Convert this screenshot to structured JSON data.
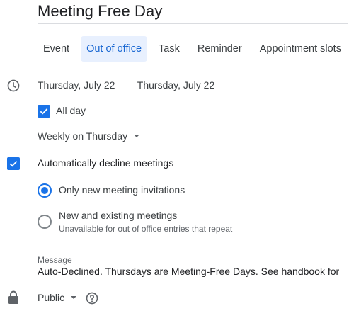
{
  "event": {
    "title": "Meeting Free Day"
  },
  "tabs": [
    {
      "label": "Event"
    },
    {
      "label": "Out of office"
    },
    {
      "label": "Task"
    },
    {
      "label": "Reminder"
    },
    {
      "label": "Appointment slots"
    }
  ],
  "active_tab": "Out of office",
  "date": {
    "start": "Thursday, July 22",
    "separator": "–",
    "end": "Thursday, July 22"
  },
  "all_day": {
    "label": "All day",
    "checked": true
  },
  "recurrence": {
    "value": "Weekly on Thursday"
  },
  "decline": {
    "label": "Automatically decline meetings",
    "checked": true,
    "options": [
      {
        "label": "Only new meeting invitations",
        "selected": true
      },
      {
        "label": "New and existing meetings",
        "selected": false,
        "note": "Unavailable for out of office entries that repeat"
      }
    ]
  },
  "message": {
    "label": "Message",
    "text": "Auto-Declined. Thursdays are Meeting-Free Days. See handbook for more details."
  },
  "visibility": {
    "value": "Public"
  },
  "icons": {
    "clock": "clock-icon",
    "checkbox": "checkbox-checked-icon",
    "lock": "lock-icon",
    "help": "help-circle-icon",
    "caret": "caret-down-icon"
  },
  "colors": {
    "accent": "#1a73e8",
    "active_tab_bg": "#e8f0fe",
    "active_tab_text": "#1967d2",
    "text": "#3c4043",
    "muted": "#5f6368"
  }
}
